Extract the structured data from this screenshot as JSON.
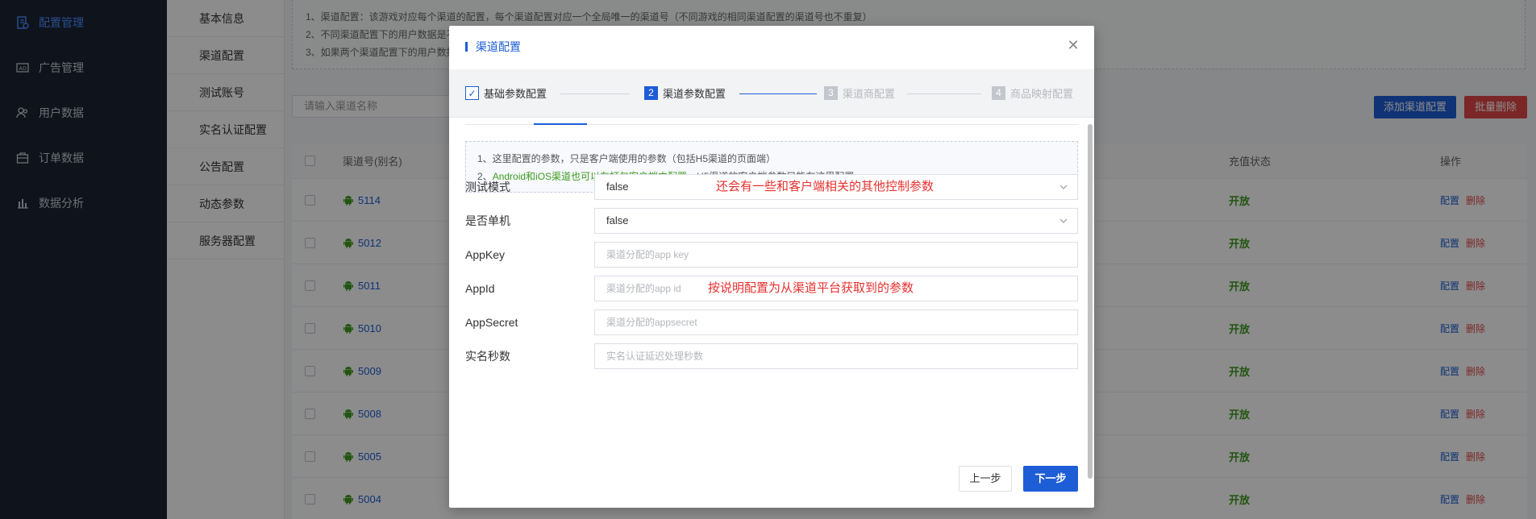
{
  "sidebar": {
    "items": [
      {
        "label": "配置管理",
        "icon": "config-doc-icon",
        "active": true
      },
      {
        "label": "广告管理",
        "icon": "ad-icon"
      },
      {
        "label": "用户数据",
        "icon": "users-icon"
      },
      {
        "label": "订单数据",
        "icon": "order-icon"
      },
      {
        "label": "数据分析",
        "icon": "chart-icon"
      }
    ]
  },
  "subnav": {
    "items": [
      "基本信息",
      "渠道配置",
      "测试账号",
      "实名认证配置",
      "公告配置",
      "动态参数",
      "服务器配置"
    ]
  },
  "notice": {
    "lines": [
      "1、渠道配置：该游戏对应每个渠道的配置，每个渠道配置对应一个全局唯一的渠道号（不同游戏的相同渠道配置的渠道号也不重复）",
      "2、不同渠道配置下的用户数据是不",
      "3、如果两个渠道配置下的用户数据"
    ]
  },
  "toolbar": {
    "search_placeholder": "请输入渠道名称",
    "add_label": "添加渠道配置",
    "delete_label": "批量删除"
  },
  "table": {
    "headers": {
      "name": "渠道号(别名)",
      "status": "充值状态",
      "ops": "操作"
    },
    "rows": [
      {
        "id": "5114",
        "status": "开放"
      },
      {
        "id": "5012",
        "status": "开放"
      },
      {
        "id": "5011",
        "status": "开放"
      },
      {
        "id": "5010",
        "status": "开放"
      },
      {
        "id": "5009",
        "status": "开放"
      },
      {
        "id": "5008",
        "status": "开放"
      },
      {
        "id": "5005",
        "status": "开放"
      },
      {
        "id": "5004",
        "status": "开放"
      }
    ],
    "op_config": "配置",
    "op_delete": "删除"
  },
  "modal": {
    "title": "渠道配置",
    "close_icon": "close-icon",
    "steps": [
      {
        "num": "",
        "label": "基础参数配置",
        "state": "done"
      },
      {
        "num": "2",
        "label": "渠道参数配置",
        "state": "active"
      },
      {
        "num": "3",
        "label": "渠道商配置",
        "state": "pending"
      },
      {
        "num": "4",
        "label": "商品映射配置",
        "state": "pending"
      }
    ],
    "tips": {
      "line1": "1、这里配置的参数，只是客户端使用的参数（包括H5渠道的页面端）",
      "line2_prefix": "2、",
      "line2_green": "Android和iOS渠道也可以在打包客户端中配置",
      "line2_suffix": "，H5渠道的客户端参数只能在这里配置"
    },
    "fields": [
      {
        "label": "测试模式",
        "type": "select",
        "value": "false",
        "annotation": "还会有一些和客户端相关的其他控制参数"
      },
      {
        "label": "是否单机",
        "type": "select",
        "value": "false",
        "annotation": ""
      },
      {
        "label": "AppKey",
        "type": "input",
        "placeholder": "渠道分配的app key",
        "annotation": ""
      },
      {
        "label": "AppId",
        "type": "input",
        "placeholder": "渠道分配的app id",
        "annotation": "按说明配置为从渠道平台获取到的参数"
      },
      {
        "label": "AppSecret",
        "type": "input",
        "placeholder": "渠道分配的appsecret",
        "annotation": ""
      },
      {
        "label": "实名秒数",
        "type": "input",
        "placeholder": "实名认证延迟处理秒数",
        "annotation": ""
      }
    ],
    "prev_label": "上一步",
    "next_label": "下一步"
  },
  "colors": {
    "primary": "#1d5dd6",
    "danger": "#e04848",
    "success": "#3e9b1f",
    "annotation": "#e5312f",
    "sidebar_bg": "#1c2333"
  }
}
